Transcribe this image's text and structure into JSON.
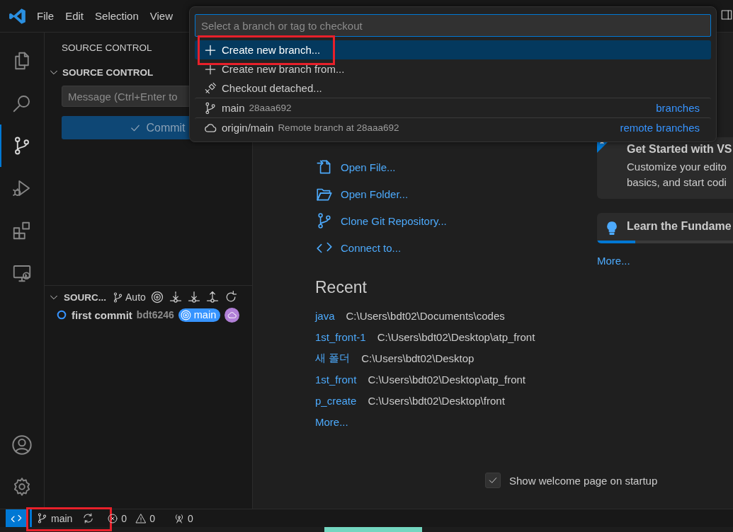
{
  "menu": [
    {
      "label": "File"
    },
    {
      "label": "Edit"
    },
    {
      "label": "Selection"
    },
    {
      "label": "View"
    }
  ],
  "activity_bar": [
    {
      "selected": false
    },
    {
      "selected": false
    },
    {
      "selected": true
    },
    {
      "selected": false
    },
    {
      "selected": false
    },
    {
      "selected": false
    }
  ],
  "sidebar": {
    "title": "SOURCE CONTROL",
    "changes": {
      "title": "SOURCE CONTROL",
      "expanded": true,
      "message": {
        "placeholder": "Message (Ctrl+Enter to"
      },
      "commit_button": {
        "label": "Commit",
        "disabled": true
      }
    },
    "graph": {
      "title": "SOURC...",
      "expanded": true,
      "branch_filter": "Auto",
      "commits": [
        {
          "message": "first commit",
          "author": "bdt6246",
          "ref": "main"
        }
      ]
    }
  },
  "welcome": {
    "start": [
      {
        "label": "Open File..."
      },
      {
        "label": "Open Folder..."
      },
      {
        "label": "Clone Git Repository..."
      },
      {
        "label": "Connect to..."
      }
    ],
    "recent_title": "Recent",
    "recent": [
      {
        "name": "java",
        "path": "C:\\Users\\bdt02\\Documents\\codes"
      },
      {
        "name": "1st_front-1",
        "path": "C:\\Users\\bdt02\\Desktop\\atp_front"
      },
      {
        "name": "새 폴더",
        "path": "C:\\Users\\bdt02\\Desktop"
      },
      {
        "name": "1st_front",
        "path": "C:\\Users\\bdt02\\Desktop\\atp_front"
      },
      {
        "name": "p_create",
        "path": "C:\\Users\\bdt02\\Desktop\\front"
      }
    ],
    "recent_more": "More...",
    "walkthroughs": [
      {
        "kind": "featured",
        "title": "Get Started with VS",
        "lines": [
          "Customize your edito",
          "basics, and start codi"
        ]
      },
      {
        "kind": "progress",
        "title": "Learn the Fundame",
        "level": 0.28
      }
    ],
    "walkthroughs_more": "More...",
    "show_on_startup": {
      "label": "Show welcome page on startup",
      "checked": true
    }
  },
  "quick_pick": {
    "placeholder": "Select a branch or tag to checkout",
    "items": [
      {
        "kind": "action",
        "label": "Create new branch...",
        "selected": true,
        "highlighted": true
      },
      {
        "kind": "action",
        "label": "Create new branch from...",
        "selected": false,
        "highlighted": false
      },
      {
        "kind": "action",
        "label": "Checkout detached...",
        "selected": false,
        "highlighted": false
      },
      {
        "kind": "branch",
        "label": "main",
        "detail": "28aaa692",
        "group": "branches",
        "selected": false,
        "highlighted": false
      },
      {
        "kind": "remote",
        "label": "origin/main",
        "detail": "Remote branch at 28aaa692",
        "group": "remote branches",
        "selected": false,
        "highlighted": false
      }
    ]
  },
  "status_bar": {
    "branch": {
      "label": "main",
      "highlighted": true
    },
    "errors": "0",
    "warnings": "0",
    "ports": "0"
  }
}
